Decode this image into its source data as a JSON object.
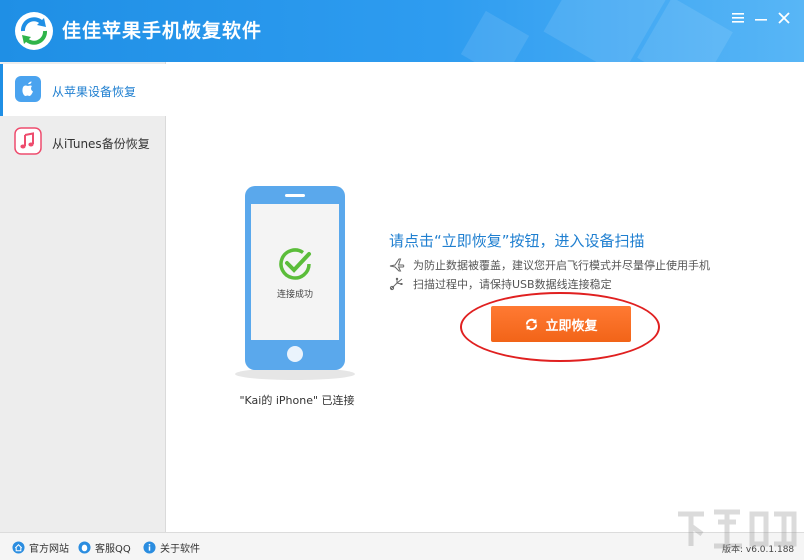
{
  "window": {
    "title": "佳佳苹果手机恢复软件"
  },
  "sidebar": {
    "items": [
      {
        "label": "从苹果设备恢复",
        "icon": "apple-icon",
        "active": true
      },
      {
        "label": "从iTunes备份恢复",
        "icon": "music-note-icon",
        "active": false
      }
    ]
  },
  "main": {
    "phone_status": "连接成功",
    "device_caption": "\"Kai的 iPhone\" 已连接",
    "instruction_title": "请点击“立即恢复”按钮，进入设备扫描",
    "tips": [
      {
        "icon": "airplane-icon",
        "text": "为防止数据被覆盖，建议您开启飞行模式并尽量停止使用手机"
      },
      {
        "icon": "usb-icon",
        "text": "扫描过程中，请保持USB数据线连接稳定"
      }
    ],
    "recover_button": "立即恢复"
  },
  "statusbar": {
    "links": [
      {
        "label": "官方网站",
        "icon": "home-icon"
      },
      {
        "label": "客服QQ",
        "icon": "qq-icon"
      },
      {
        "label": "关于软件",
        "icon": "info-icon"
      }
    ],
    "version": "版本: v6.0.1.188"
  },
  "colors": {
    "titlebar": "#1f8fe5",
    "accent_text": "#1f7fd0",
    "button": "#f26418",
    "highlight_ring": "#e02020",
    "phone_body": "#5aa8ec"
  }
}
